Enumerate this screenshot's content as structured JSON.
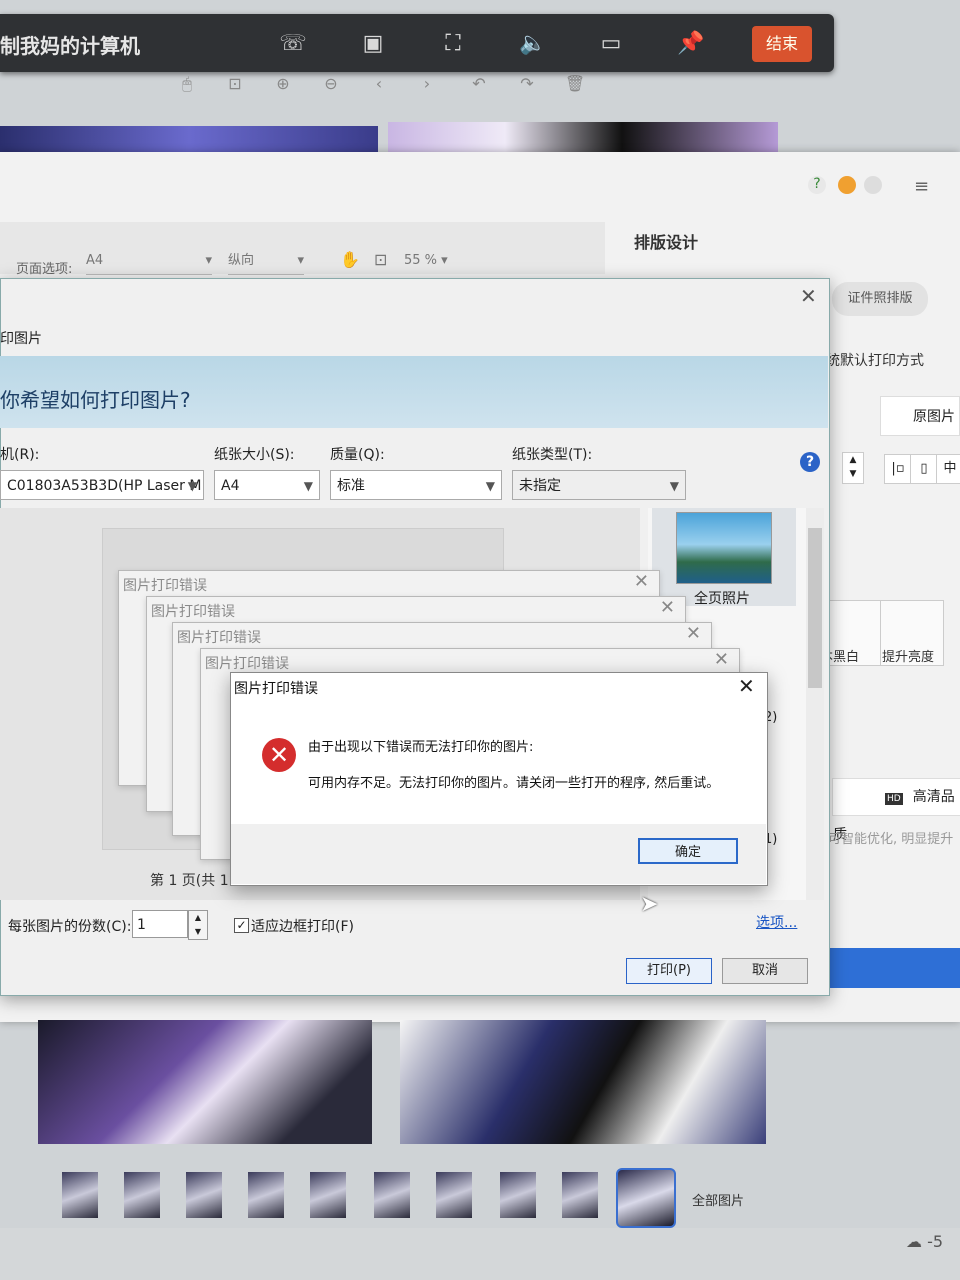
{
  "remote": {
    "title": "制我妈的计算机",
    "end_label": "结束",
    "icons": [
      "phone-icon",
      "ratio-icon",
      "fullscreen-icon",
      "volume-icon",
      "hd-icon",
      "pin-icon"
    ]
  },
  "viewer_toolbar": {
    "icons": [
      "mouse-icon",
      "actual-size-icon",
      "zoom-in-icon",
      "zoom-out-icon",
      "prev-icon",
      "next-icon",
      "rotate-left-icon",
      "rotate-right-icon",
      "delete-icon"
    ]
  },
  "app": {
    "page_option_label": "页面选项:",
    "paper": "A4",
    "orientation": "纵向",
    "zoom": "55 %",
    "layout_title": "排版设计",
    "id_photo": "证件照排版",
    "default_print": "统默认打印方式",
    "original_image": "原图片",
    "effects": [
      {
        "label": "本黑白"
      },
      {
        "label": "提升亮度"
      }
    ],
    "hd_quality": "高清品质",
    "hd_desc": "可智能优化, 明显提升"
  },
  "print_dialog": {
    "title": "印图片",
    "question": "你希望如何打印图片?",
    "printer_label": "机(R):",
    "printer_value": "C01803A53B3D(HP Laser M",
    "paper_size_label": "纸张大小(S):",
    "paper_size_value": "A4",
    "quality_label": "质量(Q):",
    "quality_value": "标准",
    "paper_type_label": "纸张类型(T):",
    "paper_type_value": "未指定",
    "page_count": "第 1 页(共 1",
    "layout_option": "全页照片",
    "copies_label": "每张图片的份数(C):",
    "copies_value": "1",
    "fit_label": "适应边框打印(F)",
    "options_link": "选项...",
    "print_button": "打印(P)",
    "cancel_button": "取消",
    "side_numbers": [
      "2)",
      "1)"
    ]
  },
  "error_stack": {
    "back_titles": [
      "图片打印错误",
      "图片打印错误",
      "图片打印错误",
      "图片打印错误"
    ],
    "front_title": "图片打印错误",
    "message_line1": "由于出现以下错误而无法打印你的图片:",
    "message_line2": "可用内存不足。无法打印你的图片。请关闭一些打开的程序, 然后重试。",
    "ok_button": "确定"
  },
  "gallery": {
    "all_pictures": "全部图片"
  },
  "taskbar": {
    "temperature": "-5"
  }
}
